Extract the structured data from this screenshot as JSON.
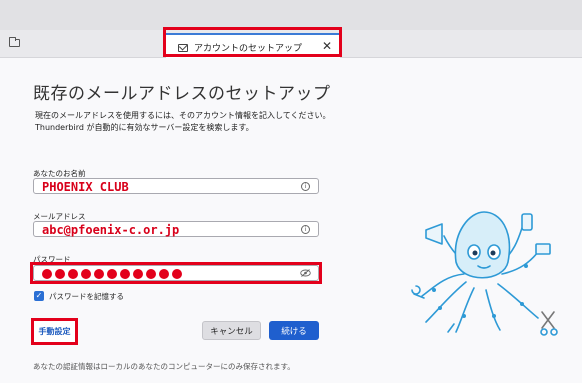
{
  "tab": {
    "title": "アカウントのセットアップ",
    "close": "✕"
  },
  "page": {
    "title": "既存のメールアドレスのセットアップ",
    "description_line1": "現在のメールアドレスを使用するには、そのアカウント情報を記入してください。",
    "description_line2": "Thunderbird が自動的に有効なサーバー設定を検索します。"
  },
  "form": {
    "name_label": "あなたのお名前",
    "name_value": "PHOENIX CLUB",
    "email_label": "メールアドレス",
    "email_value": "abc@pfoenix-c.or.jp",
    "password_label": "パスワード",
    "password_mask_count": 11,
    "remember_label": "パスワードを記憶する",
    "remember_checked": true
  },
  "buttons": {
    "manual": "手動設定",
    "cancel": "キャンセル",
    "continue": "続ける"
  },
  "footer": "あなたの認証情報はローカルのあなたのコンピューターにのみ保存されます。",
  "icons": {
    "folder": "folder-icon",
    "tab": "mail-settings-icon",
    "info": "info-icon",
    "eye": "eye-slash-icon",
    "mascot": "octopus-mascot"
  },
  "colors": {
    "highlight": "#e3001b",
    "accent": "#1f5fce",
    "value_text": "#d8001a"
  }
}
